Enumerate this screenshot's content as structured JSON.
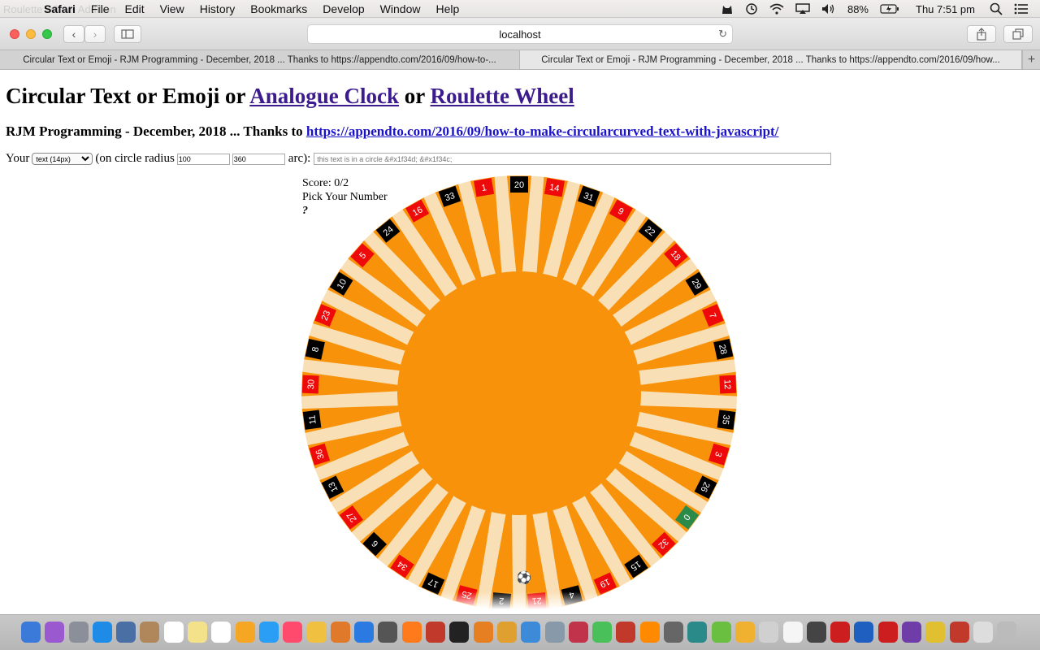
{
  "menubar": {
    "ghost_title": "Roulette Wheel Addition",
    "app": "Safari",
    "items": [
      "File",
      "Edit",
      "View",
      "History",
      "Bookmarks",
      "Develop",
      "Window",
      "Help"
    ],
    "battery": "88%",
    "clock": "Thu 7:51 pm"
  },
  "browser": {
    "url": "localhost",
    "tabs": [
      "Circular Text or Emoji - RJM Programming - December, 2018 ... Thanks to https://appendto.com/2016/09/how-to-...",
      "Circular Text or Emoji - RJM Programming - December, 2018 ... Thanks to https://appendto.com/2016/09/how..."
    ]
  },
  "page": {
    "title_prefix": "Circular Text or Emoji or ",
    "link_clock": "Analogue Clock",
    "or": " or ",
    "link_roulette": "Roulette Wheel",
    "subtitle_prefix": "RJM Programming - December, 2018 ... Thanks to ",
    "subtitle_link": "https://appendto.com/2016/09/how-to-make-circularcurved-text-with-javascript/",
    "your_label": "Your",
    "select_value": "text (14px)",
    "radius_label": "(on circle radius",
    "radius_value": "100",
    "arc_value": "360",
    "arc_label": "arc):",
    "arc_placeholder": "this text is in a circle &#x1f34d; &#x1f34c;"
  },
  "game": {
    "score": "Score: 0/2",
    "prompt": "Pick Your Number",
    "answer": "?"
  },
  "wheel": {
    "numbers": [
      "20",
      "14",
      "31",
      "9",
      "22",
      "18",
      "29",
      "7",
      "28",
      "12",
      "35",
      "3",
      "26",
      "0",
      "32",
      "15",
      "19",
      "4",
      "21",
      "2",
      "25",
      "17",
      "34",
      "6",
      "27",
      "13",
      "36",
      "11",
      "30",
      "8",
      "23",
      "10",
      "5",
      "24",
      "16",
      "33",
      "1"
    ],
    "colors": [
      "black",
      "red",
      "black",
      "red",
      "black",
      "red",
      "black",
      "red",
      "black",
      "red",
      "black",
      "red",
      "black",
      "green",
      "red",
      "black",
      "red",
      "black",
      "red",
      "black",
      "red",
      "black",
      "red",
      "black",
      "red",
      "black",
      "red",
      "black",
      "red",
      "black",
      "red",
      "black",
      "red",
      "black",
      "red",
      "black",
      "red"
    ],
    "palette": {
      "red": "#ee0a0a",
      "black": "#000000",
      "green": "#2a8a4a",
      "orange": "#f7920a",
      "cream": "#f9dfb5"
    },
    "ball": "⚽"
  }
}
